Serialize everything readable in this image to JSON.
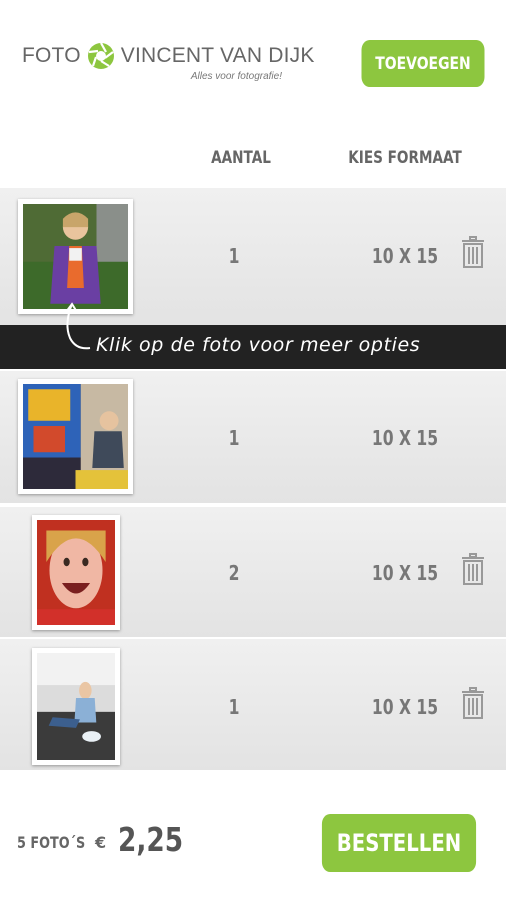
{
  "header": {
    "logo_main_left": "FOTO",
    "logo_main_right": "VINCENT VAN DIJK",
    "logo_tagline": "Alles voor fotografie!",
    "add_button": "TOEVOEGEN"
  },
  "columns": {
    "quantity": "AANTAL",
    "format": "KIES FORMAAT"
  },
  "hint": "Klik op de foto voor meer opties",
  "rows": [
    {
      "quantity": "1",
      "format": "10 X 15",
      "photo": "girl-purple-jacket-garden",
      "deletable": true
    },
    {
      "quantity": "1",
      "format": "10 X 15",
      "photo": "boy-arcade-game",
      "deletable": false
    },
    {
      "quantity": "2",
      "format": "10 X 15",
      "photo": "child-red-hood-face",
      "deletable": true
    },
    {
      "quantity": "1",
      "format": "10 X 15",
      "photo": "toddler-floor-bowl",
      "deletable": true
    }
  ],
  "footer": {
    "count": "5 FOTO´S",
    "currency": "€",
    "price": "2,25",
    "order_button": "BESTELLEN"
  },
  "colors": {
    "accent": "#8dc63f",
    "hint_bar": "#222222",
    "text": "#666666"
  }
}
